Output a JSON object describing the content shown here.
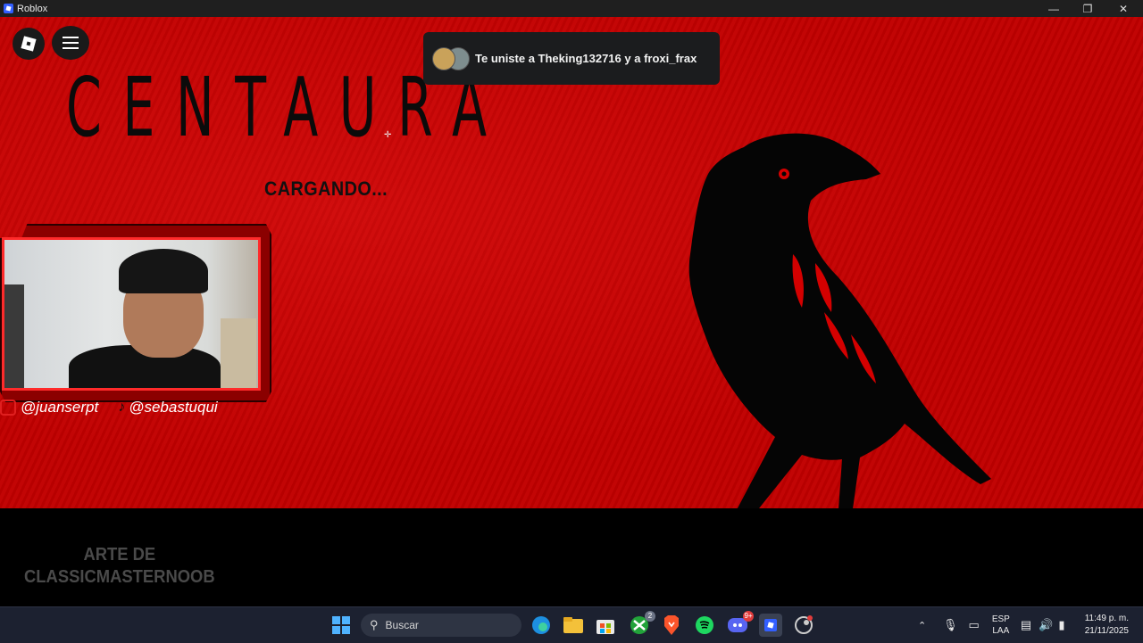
{
  "window": {
    "title": "Roblox"
  },
  "game": {
    "title": "CENTAURA",
    "loading_text": "CARGANDO...",
    "notification": "Te uniste a Theking132716 y a froxi_frax",
    "credit_line1": "ARTE DE",
    "credit_line2": "CLASSICMASTERNOOB"
  },
  "stream": {
    "instagram_handle": "@juanserpt",
    "tiktok_handle": "@sebastuqui"
  },
  "taskbar": {
    "search_placeholder": "Buscar",
    "xbox_badge": "2",
    "discord_badge": "9+",
    "language_line1": "ESP",
    "language_line2": "LAA",
    "time": "11:49 p. m.",
    "date": "21/11/2025"
  },
  "colors": {
    "game_bg": "#c10000",
    "accent_red": "#ff2a2a",
    "taskbar_bg": "#1c2130"
  }
}
